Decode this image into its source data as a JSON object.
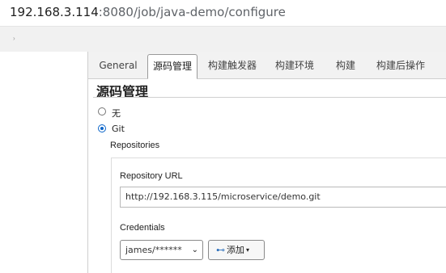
{
  "browser": {
    "url_host": "192.168.3.114",
    "url_rest": ":8080/job/java-demo/configure",
    "bookmark_chevron": "›"
  },
  "tabs": [
    {
      "label": "General",
      "active": false
    },
    {
      "label": "源码管理",
      "active": true
    },
    {
      "label": "构建触发器",
      "active": false
    },
    {
      "label": "构建环境",
      "active": false
    },
    {
      "label": "构建",
      "active": false
    },
    {
      "label": "构建后操作",
      "active": false
    }
  ],
  "scm": {
    "title": "源码管理",
    "options": [
      {
        "label": "无",
        "checked": false
      },
      {
        "label": "Git",
        "checked": true
      }
    ],
    "repositories_label": "Repositories",
    "repository_url_label": "Repository URL",
    "repository_url_value": "http://192.168.3.115/microservice/demo.git",
    "credentials_label": "Credentials",
    "credentials_selected": "james/******",
    "add_button_label": "添加",
    "add_button_caret": "▾"
  },
  "colors": {
    "accent_radio": "#0a64c8",
    "tabbar_bg": "#f2f2f2"
  }
}
